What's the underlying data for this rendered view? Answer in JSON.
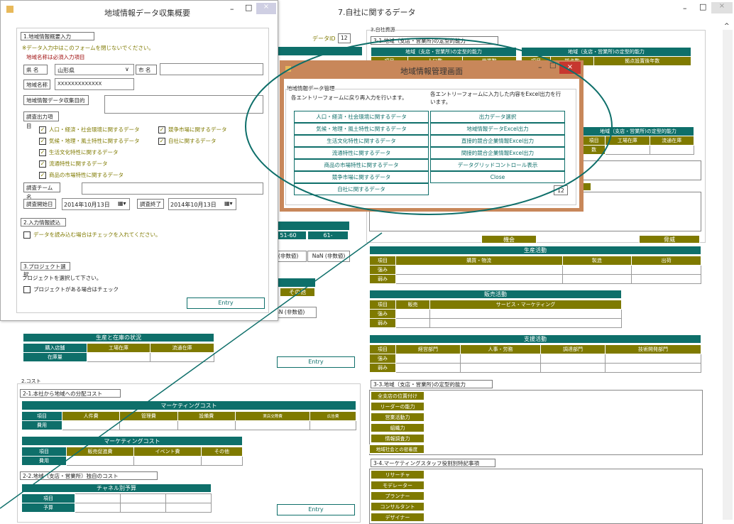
{
  "back_window": {
    "title": "7.自社に関するデータ",
    "controls": [
      "–",
      "□",
      "×"
    ],
    "data_id_label": "データID",
    "data_id_value": "12",
    "section3_title": "3.自社資源",
    "sec3_1_title": "3-1.地域（支店・営業所)の定型的能力",
    "tbl31a_header": "地域（支店・営業所)の定型的能力",
    "tbl31a_cols": [
      "項目",
      "人口数",
      "世帯数"
    ],
    "tbl31b_header": "地域（支店・営業所)の定型的能力",
    "tbl31b_cols": [
      "項目",
      "拠点数",
      "拠点設置後年数"
    ],
    "tbl_stock_header": "地域（支店・営業所)の定型的能力",
    "tbl_stock_cols": [
      "項目",
      "工場在庫",
      "流通在庫"
    ],
    "tbl_stock_row": "数",
    "opportunity_label": "機会",
    "threat_label": "脅威",
    "age_cols": [
      "51-60",
      "61-"
    ],
    "nan_values": [
      "NaN (非数値)",
      "NaN (非数値)"
    ],
    "other_label": "その他",
    "nan_single": "NaN (非数値)",
    "production": {
      "header": "生産活動",
      "cols": [
        "項目",
        "購買・物流",
        "製造",
        "出荷"
      ],
      "rows": [
        "強み",
        "弱み"
      ]
    },
    "sales": {
      "header": "販売活動",
      "cols": [
        "項目",
        "販売",
        "サービス・マーケティング"
      ],
      "rows": [
        "強み",
        "弱み"
      ]
    },
    "support": {
      "header": "支援活動",
      "cols": [
        "項目",
        "経営部門",
        "人事・労務",
        "調達部門",
        "技術開発部門"
      ],
      "rows": [
        "強み",
        "弱み"
      ]
    },
    "sec3_3_title": "3-3.地域（支店・営業所)の定型的能力",
    "sec3_3_rows": [
      "全支店の位置付け",
      "リーダーの能力",
      "営業活動力",
      "組織力",
      "情報調査力",
      "地域社会との密着度"
    ],
    "sec3_4_title": "3-4.マーケティングスタッフ役割別特記事項",
    "sec3_4_rows": [
      "リサーチャ",
      "モデレーター",
      "プランナー",
      "コンサルタント",
      "デザイナー"
    ],
    "inventory": {
      "header": "生産と在庫の状況",
      "cols": [
        "購入店舗",
        "工場在庫",
        "流通在庫"
      ],
      "row": "在庫量"
    },
    "entry_label": "Entry",
    "section2_title": "2.コスト",
    "sec2_1_title": "2-1.本社から地域への分配コスト",
    "mkt1": {
      "header": "マーケティングコスト",
      "cols": [
        "項目",
        "人件費",
        "管理費",
        "設備費",
        "実店交際費",
        "広告費"
      ],
      "row": "費用"
    },
    "mkt2": {
      "header": "マーケティングコスト",
      "cols": [
        "項目",
        "販売促進費",
        "イベント費",
        "その他"
      ],
      "row": "費用"
    },
    "sec2_2_title": "2-2.地域（支店・営業所）独自のコスト",
    "channel": {
      "header": "チャネル別予算",
      "rows": [
        "項目",
        "予算"
      ]
    },
    "entry_label2": "Entry"
  },
  "left_window": {
    "title": "地域情報データ収集概要",
    "sec1_title": "1.地域情報概要入力",
    "note": "※データ入力中はこのフォームを閉じないでください。",
    "required": "地域名称は必須入力項目",
    "prefecture_label": "県 名",
    "prefecture_value": "山形県",
    "city_label": "市 名",
    "region_label": "地域名称",
    "region_value": "XXXXXXXXXXXXX",
    "purpose_label": "地域情報データ収集目的",
    "survey_items_label": "調査出力項目",
    "checks": [
      {
        "label": "人口・経済・社会環境に関するデータ",
        "checked": true
      },
      {
        "label": "競争市場に関するデータ",
        "checked": true
      },
      {
        "label": "気候・地理・風土特性に関するデータ",
        "checked": true
      },
      {
        "label": "自社に関するデータ",
        "checked": true
      },
      {
        "label": "生活文化特性に関するデータ",
        "checked": true
      },
      {
        "label": "流通特性に関するデータ",
        "checked": true
      },
      {
        "label": "商品の市場特性に関するデータ",
        "checked": true
      }
    ],
    "team_label": "調査チーム名",
    "start_label": "調査開始日",
    "start_value": "2014年10月13日",
    "end_label": "調査終了",
    "end_value": "2014年10月13日",
    "sec2_title": "2.入力情報読込",
    "load_check": "データを読み込む場合はチェックを入れてください。",
    "sec3_title": "3.プロジェクト選択",
    "select_project": "プロジェクトを選択して下さい。",
    "project_check": "プロジェクトがある場合はチェック",
    "entry_label": "Entry"
  },
  "mgmt_window": {
    "title": "地域情報管理画面",
    "group_label": "地域情報データ管理",
    "left_desc": "各エントリーフォームに戻り再入力を行います。",
    "right_desc": "各エントリーフォームに入力した内容をExcel出力を行います。",
    "left_buttons": [
      "人口・経済・社会環境に関するデータ",
      "気候・地理・風土特性に関するデータ",
      "生活文化特性に関するデータ",
      "流通特性に関するデータ",
      "商品の市場特性に関するデータ",
      "競争市場に関するデータ",
      "自社に関するデータ"
    ],
    "right_buttons": [
      "出力データ選択",
      "地域情報データExcel出力",
      "直接的競合企業情報Excel出力",
      "間接的競合企業情報Excel出力",
      "データグリッドコントロール表示",
      "Close"
    ],
    "id_value": "12"
  },
  "colors": {
    "teal": "#0e6f6a",
    "olive": "#7f7a00",
    "mgmt_border": "#c8875a"
  }
}
